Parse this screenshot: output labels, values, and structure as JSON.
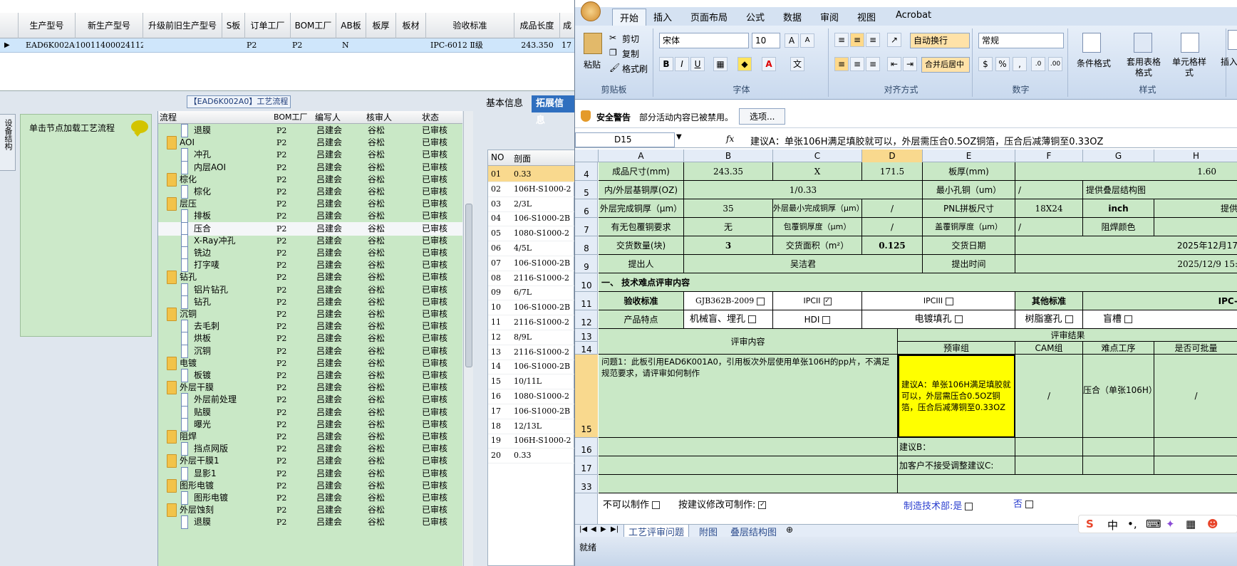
{
  "top_grid": {
    "headers": [
      "生产型号",
      "新生产型号",
      "升级前旧生产型号",
      "S板",
      "订单工厂",
      "BOM工厂",
      "AB板",
      "板厚",
      "板材",
      "验收标准",
      "成品长度",
      "成"
    ],
    "row": {
      "prod_no": "EAD6K002A0",
      "new_prod_no": "10011400024112",
      "order_factory": "P2",
      "bom_factory": "P2",
      "ab": "N",
      "standard": "IPC-6012 Ⅱ级",
      "length": "243.350",
      "more": "17"
    }
  },
  "left_panel": {
    "side_tab": "设备结构",
    "hint": "单击节点加载工艺流程",
    "flow_title": "【EAD6K002A0】工艺流程"
  },
  "tree": {
    "headers": {
      "flow": "流程",
      "bom": "BOM工厂",
      "writer": "编写人",
      "reviewer": "核审人",
      "status": "状态"
    },
    "rows": [
      {
        "level": 2,
        "type": "doc",
        "name": "退膜",
        "bom": "P2",
        "writer": "吕建会",
        "reviewer": "谷松",
        "status": "已审核"
      },
      {
        "level": 1,
        "type": "folder",
        "name": "AOI",
        "bom": "P2",
        "writer": "吕建会",
        "reviewer": "谷松",
        "status": "已审核"
      },
      {
        "level": 2,
        "type": "doc",
        "name": "冲孔",
        "bom": "P2",
        "writer": "吕建会",
        "reviewer": "谷松",
        "status": "已审核"
      },
      {
        "level": 2,
        "type": "doc",
        "name": "内层AOI",
        "bom": "P2",
        "writer": "吕建会",
        "reviewer": "谷松",
        "status": "已审核"
      },
      {
        "level": 1,
        "type": "folder",
        "name": "棕化",
        "bom": "P2",
        "writer": "吕建会",
        "reviewer": "谷松",
        "status": "已审核"
      },
      {
        "level": 2,
        "type": "doc",
        "name": "棕化",
        "bom": "P2",
        "writer": "吕建会",
        "reviewer": "谷松",
        "status": "已审核"
      },
      {
        "level": 1,
        "type": "folder",
        "name": "层压",
        "bom": "P2",
        "writer": "吕建会",
        "reviewer": "谷松",
        "status": "已审核"
      },
      {
        "level": 2,
        "type": "doc",
        "name": "排板",
        "bom": "P2",
        "writer": "吕建会",
        "reviewer": "谷松",
        "status": "已审核"
      },
      {
        "level": 2,
        "type": "doc",
        "name": "压合",
        "bom": "P2",
        "writer": "吕建会",
        "reviewer": "谷松",
        "status": "已审核",
        "selected": true
      },
      {
        "level": 2,
        "type": "doc",
        "name": "X-Ray冲孔",
        "bom": "P2",
        "writer": "吕建会",
        "reviewer": "谷松",
        "status": "已审核"
      },
      {
        "level": 2,
        "type": "doc",
        "name": "铣边",
        "bom": "P2",
        "writer": "吕建会",
        "reviewer": "谷松",
        "status": "已审核"
      },
      {
        "level": 2,
        "type": "doc",
        "name": "打字唛",
        "bom": "P2",
        "writer": "吕建会",
        "reviewer": "谷松",
        "status": "已审核"
      },
      {
        "level": 1,
        "type": "folder",
        "name": "钻孔",
        "bom": "P2",
        "writer": "吕建会",
        "reviewer": "谷松",
        "status": "已审核"
      },
      {
        "level": 2,
        "type": "doc",
        "name": "铝片钻孔",
        "bom": "P2",
        "writer": "吕建会",
        "reviewer": "谷松",
        "status": "已审核"
      },
      {
        "level": 2,
        "type": "doc",
        "name": "钻孔",
        "bom": "P2",
        "writer": "吕建会",
        "reviewer": "谷松",
        "status": "已审核"
      },
      {
        "level": 1,
        "type": "folder",
        "name": "沉铜",
        "bom": "P2",
        "writer": "吕建会",
        "reviewer": "谷松",
        "status": "已审核"
      },
      {
        "level": 2,
        "type": "doc",
        "name": "去毛刺",
        "bom": "P2",
        "writer": "吕建会",
        "reviewer": "谷松",
        "status": "已审核"
      },
      {
        "level": 2,
        "type": "doc",
        "name": "烘板",
        "bom": "P2",
        "writer": "吕建会",
        "reviewer": "谷松",
        "status": "已审核"
      },
      {
        "level": 2,
        "type": "doc",
        "name": "沉铜",
        "bom": "P2",
        "writer": "吕建会",
        "reviewer": "谷松",
        "status": "已审核"
      },
      {
        "level": 1,
        "type": "folder",
        "name": "电镀",
        "bom": "P2",
        "writer": "吕建会",
        "reviewer": "谷松",
        "status": "已审核"
      },
      {
        "level": 2,
        "type": "doc",
        "name": "板镀",
        "bom": "P2",
        "writer": "吕建会",
        "reviewer": "谷松",
        "status": "已审核"
      },
      {
        "level": 1,
        "type": "folder",
        "name": "外层干膜",
        "bom": "P2",
        "writer": "吕建会",
        "reviewer": "谷松",
        "status": "已审核"
      },
      {
        "level": 2,
        "type": "doc",
        "name": "外层前处理",
        "bom": "P2",
        "writer": "吕建会",
        "reviewer": "谷松",
        "status": "已审核"
      },
      {
        "level": 2,
        "type": "doc",
        "name": "贴膜",
        "bom": "P2",
        "writer": "吕建会",
        "reviewer": "谷松",
        "status": "已审核"
      },
      {
        "level": 2,
        "type": "doc",
        "name": "曝光",
        "bom": "P2",
        "writer": "吕建会",
        "reviewer": "谷松",
        "status": "已审核"
      },
      {
        "level": 1,
        "type": "folder",
        "name": "阻焊",
        "bom": "P2",
        "writer": "吕建会",
        "reviewer": "谷松",
        "status": "已审核"
      },
      {
        "level": 2,
        "type": "doc",
        "name": "挡点网版",
        "bom": "P2",
        "writer": "吕建会",
        "reviewer": "谷松",
        "status": "已审核"
      },
      {
        "level": 1,
        "type": "folder",
        "name": "外层干膜1",
        "bom": "P2",
        "writer": "吕建会",
        "reviewer": "谷松",
        "status": "已审核"
      },
      {
        "level": 2,
        "type": "doc",
        "name": "显影1",
        "bom": "P2",
        "writer": "吕建会",
        "reviewer": "谷松",
        "status": "已审核"
      },
      {
        "level": 1,
        "type": "folder",
        "name": "图形电镀",
        "bom": "P2",
        "writer": "吕建会",
        "reviewer": "谷松",
        "status": "已审核"
      },
      {
        "level": 2,
        "type": "doc",
        "name": "图形电镀",
        "bom": "P2",
        "writer": "吕建会",
        "reviewer": "谷松",
        "status": "已审核"
      },
      {
        "level": 1,
        "type": "folder",
        "name": "外层蚀刻",
        "bom": "P2",
        "writer": "吕建会",
        "reviewer": "谷松",
        "status": "已审核"
      },
      {
        "level": 2,
        "type": "doc",
        "name": "退膜",
        "bom": "P2",
        "writer": "吕建会",
        "reviewer": "谷松",
        "status": "已审核"
      }
    ]
  },
  "mid_panel": {
    "tabs": [
      "基本信息",
      "拓展信息"
    ],
    "headers": {
      "no": "NO",
      "section": "剖面"
    },
    "rows": [
      {
        "no": "01",
        "val": "0.33"
      },
      {
        "no": "02",
        "val": "106H-S1000-2"
      },
      {
        "no": "03",
        "val": "2/3L"
      },
      {
        "no": "04",
        "val": "106-S1000-2B"
      },
      {
        "no": "05",
        "val": "1080-S1000-2"
      },
      {
        "no": "06",
        "val": "4/5L"
      },
      {
        "no": "07",
        "val": "106-S1000-2B"
      },
      {
        "no": "08",
        "val": "2116-S1000-2"
      },
      {
        "no": "09",
        "val": "6/7L"
      },
      {
        "no": "10",
        "val": "106-S1000-2B"
      },
      {
        "no": "11",
        "val": "2116-S1000-2"
      },
      {
        "no": "12",
        "val": "8/9L"
      },
      {
        "no": "13",
        "val": "2116-S1000-2"
      },
      {
        "no": "14",
        "val": "106-S1000-2B"
      },
      {
        "no": "15",
        "val": "10/11L"
      },
      {
        "no": "16",
        "val": "1080-S1000-2"
      },
      {
        "no": "17",
        "val": "106-S1000-2B"
      },
      {
        "no": "18",
        "val": "12/13L"
      },
      {
        "no": "19",
        "val": "106H-S1000-2"
      },
      {
        "no": "20",
        "val": "0.33"
      }
    ]
  },
  "excel": {
    "tabs": [
      "开始",
      "插入",
      "页面布局",
      "公式",
      "数据",
      "审阅",
      "视图",
      "Acrobat"
    ],
    "clipboard": {
      "cut": "剪切",
      "copy": "复制",
      "format_painter": "格式刷",
      "paste": "粘贴",
      "label": "剪贴板"
    },
    "font": {
      "name": "宋体",
      "size": "10",
      "label": "字体"
    },
    "align": {
      "wrap": "自动换行",
      "merge": "合并后居中",
      "label": "对齐方式"
    },
    "number": {
      "format": "常规",
      "label": "数字"
    },
    "styles": {
      "cond": "条件格式",
      "table": "套用表格格式",
      "cell": "单元格样式",
      "label": "样式"
    },
    "insert": "插入",
    "security": {
      "title": "安全警告",
      "msg": "部分活动内容已被禁用。",
      "btn": "选项..."
    },
    "name_box": "D15",
    "fx": "fx",
    "formula": "建议A：单张106H满足填胶就可以，外层需压合0.5OZ铜箔，压合后减薄铜至0.33OZ",
    "cols": [
      "A",
      "B",
      "C",
      "D",
      "E",
      "F",
      "G",
      "H"
    ],
    "rows": [
      "4",
      "5",
      "6",
      "7",
      "8",
      "9",
      "10",
      "11",
      "12",
      "13",
      "14",
      "15",
      "16",
      "17",
      "33"
    ],
    "cells": {
      "r4": [
        "成品尺寸(mm)",
        "243.35",
        "X",
        "171.5",
        "板厚(mm)",
        "1.60"
      ],
      "r5": [
        "内/外层基铜厚(OZ)",
        "1/0.33",
        "最小孔铜（um）",
        "/",
        "提供叠层结构图"
      ],
      "r6": [
        "外层完成铜厚（μm）",
        "35",
        "外层最小完成铜厚（μm）",
        "/",
        "PNL拼板尺寸",
        "18X24",
        "inch",
        "提供"
      ],
      "r7": [
        "有无包覆铜要求",
        "无",
        "包覆铜厚度（μm）",
        "/",
        "盖覆铜厚度（μm）",
        "/",
        "阻焊颜色"
      ],
      "r8": [
        "交货数量(块)",
        "3",
        "交货面积（m²）",
        "0.125",
        "交货日期",
        "2025年12月17"
      ],
      "r9": [
        "提出人",
        "吴洁君",
        "提出时间",
        "2025/12/9 15:"
      ],
      "r10": "一、 技术难点评审内容",
      "r11": [
        "验收标准",
        "GJB362B-2009",
        "IPCII",
        "IPCIII",
        "其他标准",
        "IPC-"
      ],
      "r12": [
        "产品特点",
        "机械盲、埋孔",
        "HDI",
        "电镀填孔",
        "树脂塞孔",
        "盲槽"
      ],
      "r13": [
        "评审内容",
        "评审结果"
      ],
      "r14": [
        "预审组",
        "CAM组",
        "难点工序",
        "是否可批量"
      ],
      "r15": [
        "问题1：此板引用EAD6K001A0，引用板次外层使用单张106H的pp片，不满足规范要求，请评审如何制作",
        "建议A：单张106H满足填胶就可以，外层需压合0.5OZ铜箔，压合后减薄铜至0.33OZ",
        "/",
        "压合（单张106H）",
        "/"
      ],
      "r16": "建议B：",
      "r17": "加客户不接受调整建议C:",
      "r34": [
        "不可以制作",
        "按建议修改可制作:",
        "制造技术部:是",
        "否"
      ]
    },
    "sheet_tabs": [
      "工艺评审问题",
      "附图",
      "叠层结构图"
    ],
    "status": "就绪",
    "highlight_color": "#ffff00"
  }
}
